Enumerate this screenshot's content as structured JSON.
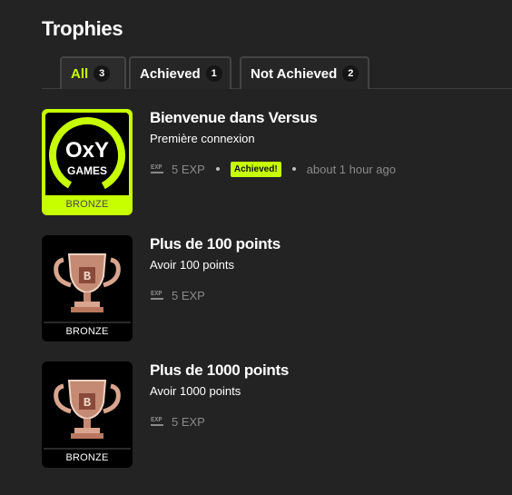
{
  "page": {
    "title": "Trophies"
  },
  "tabs": [
    {
      "label": "All",
      "count": "3"
    },
    {
      "label": "Achieved",
      "count": "1"
    },
    {
      "label": "Not Achieved",
      "count": "2"
    }
  ],
  "colors": {
    "accent": "#c8ff00",
    "background": "#232323",
    "muted": "#8a8a8a"
  },
  "trophies": [
    {
      "name": "Bienvenue dans Versus",
      "description": "Première connexion",
      "exp": "5 EXP",
      "exp_icon_text": "EXP",
      "tier": "BRONZE",
      "status": "Achieved!",
      "when": "about 1 hour ago",
      "logo": {
        "line1": "OxY",
        "line2": "GAMES"
      }
    },
    {
      "name": "Plus de 100 points",
      "description": "Avoir 100 points",
      "exp": "5 EXP",
      "exp_icon_text": "EXP",
      "tier": "BRONZE",
      "cup_letter": "B"
    },
    {
      "name": "Plus de 1000 points",
      "description": "Avoir 1000 points",
      "exp": "5 EXP",
      "exp_icon_text": "EXP",
      "tier": "BRONZE",
      "cup_letter": "B"
    }
  ]
}
